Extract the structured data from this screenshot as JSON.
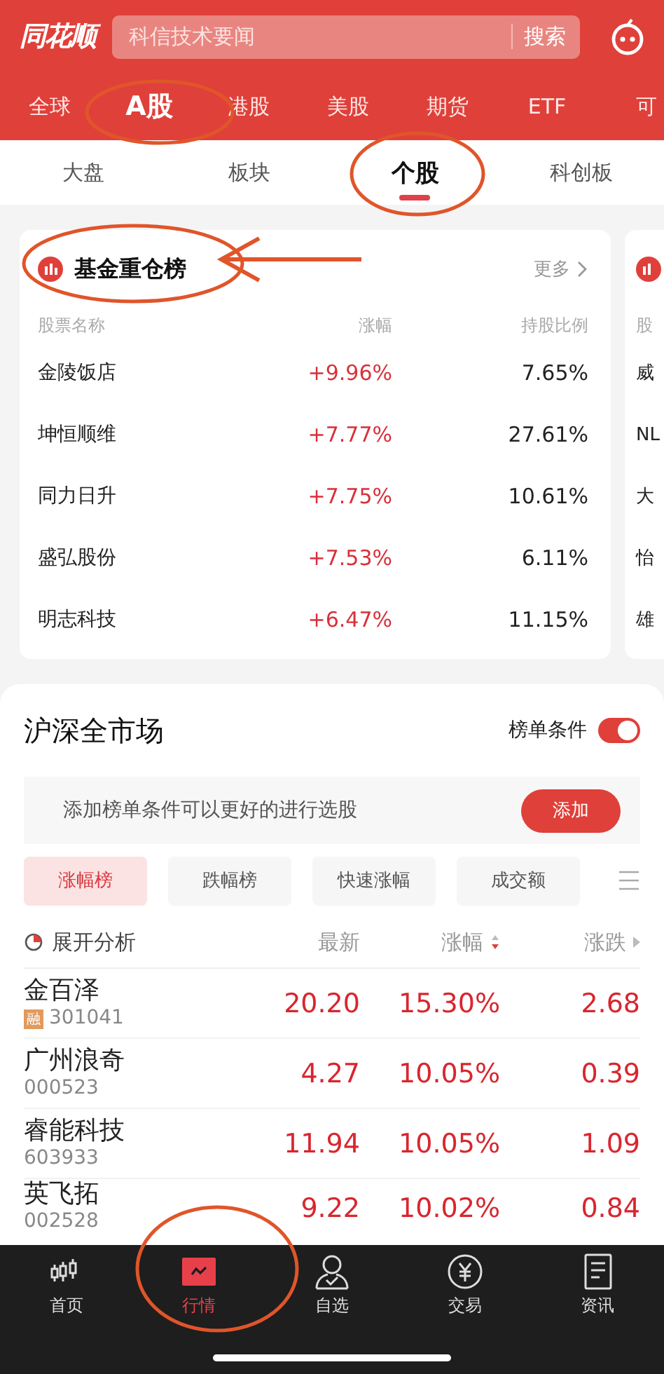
{
  "header": {
    "logo": "同花顺",
    "search": {
      "placeholder": "科信技术要闻"
    },
    "search_button": "搜索"
  },
  "market_tabs": [
    {
      "label": "全球",
      "selected": false
    },
    {
      "label": "A股",
      "selected": true
    },
    {
      "label": "港股",
      "selected": false
    },
    {
      "label": "美股",
      "selected": false
    },
    {
      "label": "期货",
      "selected": false
    },
    {
      "label": "ETF",
      "selected": false
    },
    {
      "label": "可",
      "selected": false
    }
  ],
  "sub_tabs": [
    {
      "label": "大盘",
      "selected": false
    },
    {
      "label": "板块",
      "selected": false
    },
    {
      "label": "个股",
      "selected": true
    },
    {
      "label": "科创板",
      "selected": false
    }
  ],
  "fund_card": {
    "title": "基金重仓榜",
    "more": "更多",
    "columns": [
      "股票名称",
      "涨幅",
      "持股比例"
    ],
    "rows": [
      {
        "name": "金陵饭店",
        "change": "+9.96%",
        "ratio": "7.65%"
      },
      {
        "name": "坤恒顺维",
        "change": "+7.77%",
        "ratio": "27.61%"
      },
      {
        "name": "同力日升",
        "change": "+7.75%",
        "ratio": "10.61%"
      },
      {
        "name": "盛弘股份",
        "change": "+7.53%",
        "ratio": "6.11%"
      },
      {
        "name": "明志科技",
        "change": "+6.47%",
        "ratio": "11.15%"
      }
    ]
  },
  "peek_card": {
    "column_1": "股",
    "rows": [
      "威",
      "NL",
      "大",
      "怡",
      "雄"
    ]
  },
  "market": {
    "title": "沪深全市场",
    "toggle": {
      "label": "榜单条件",
      "on": true
    },
    "hint": "添加榜单条件可以更好的进行选股",
    "add_button": "添加",
    "filters": [
      {
        "label": "涨幅榜",
        "selected": true
      },
      {
        "label": "跌幅榜",
        "selected": false
      },
      {
        "label": "快速涨幅",
        "selected": false
      },
      {
        "label": "成交额",
        "selected": false
      }
    ],
    "analysis": "展开分析",
    "columns": [
      "最新",
      "涨幅",
      "涨跌"
    ],
    "rows": [
      {
        "name": "金百泽",
        "tag": "融",
        "code": "301041",
        "price": "20.20",
        "change": "15.30%",
        "diff": "2.68"
      },
      {
        "name": "广州浪奇",
        "code": "000523",
        "price": "4.27",
        "change": "10.05%",
        "diff": "0.39"
      },
      {
        "name": "睿能科技",
        "code": "603933",
        "price": "11.94",
        "change": "10.05%",
        "diff": "1.09"
      },
      {
        "name": "英飞拓",
        "code": "002528",
        "price": "9.22",
        "change": "10.02%",
        "diff": "0.84"
      }
    ]
  },
  "bottom_nav": [
    {
      "label": "首页",
      "kind": "candles",
      "selected": false
    },
    {
      "label": "行情",
      "kind": "chart",
      "selected": true
    },
    {
      "label": "自选",
      "kind": "person",
      "selected": false
    },
    {
      "label": "交易",
      "kind": "yen",
      "selected": false
    },
    {
      "label": "资讯",
      "kind": "doc",
      "selected": false
    }
  ]
}
